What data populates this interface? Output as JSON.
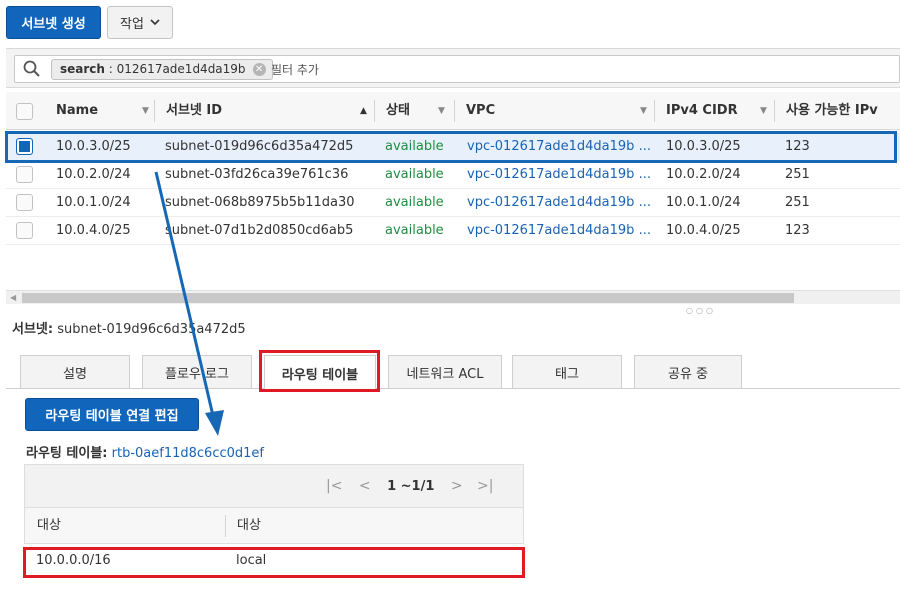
{
  "toolbar": {
    "create_subnet_label": "서브넷 생성",
    "actions_label": "작업"
  },
  "search": {
    "token_key": "search",
    "token_value": "012617ade1d4da19b",
    "filter_placeholder": "필터 추가"
  },
  "table": {
    "columns": [
      "Name",
      "서브넷 ID",
      "상태",
      "VPC",
      "IPv4 CIDR",
      "사용 가능한 IPv"
    ],
    "rows": [
      {
        "name": "10.0.3.0/25",
        "subnet_id": "subnet-019d96c6d35a472d5",
        "state": "available",
        "vpc": "vpc-012617ade1d4da19b ...",
        "cidr": "10.0.3.0/25",
        "available_ips": "123",
        "selected": true
      },
      {
        "name": "10.0.2.0/24",
        "subnet_id": "subnet-03fd26ca39e761c36",
        "state": "available",
        "vpc": "vpc-012617ade1d4da19b ...",
        "cidr": "10.0.2.0/24",
        "available_ips": "251",
        "selected": false
      },
      {
        "name": "10.0.1.0/24",
        "subnet_id": "subnet-068b8975b5b11da30",
        "state": "available",
        "vpc": "vpc-012617ade1d4da19b ...",
        "cidr": "10.0.1.0/24",
        "available_ips": "251",
        "selected": false
      },
      {
        "name": "10.0.4.0/25",
        "subnet_id": "subnet-07d1b2d0850cd6ab5",
        "state": "available",
        "vpc": "vpc-012617ade1d4da19b ...",
        "cidr": "10.0.4.0/25",
        "available_ips": "123",
        "selected": false
      }
    ]
  },
  "detail": {
    "subnet_label": "서브넷:",
    "subnet_value": "subnet-019d96c6d35a472d5",
    "tabs": [
      "설명",
      "플로우 로그",
      "라우팅 테이블",
      "네트워크 ACL",
      "태그",
      "공유 중"
    ],
    "active_tab": "라우팅 테이블",
    "edit_button_label": "라우팅 테이블 연결 편집",
    "route_table_label": "라우팅 테이블:",
    "route_table_id": "rtb-0aef11d8c6cc0d1ef",
    "pagination": "1 ~1/1",
    "route_columns": [
      "대상",
      "대상"
    ],
    "routes": [
      {
        "destination": "10.0.0.0/16",
        "target": "local"
      }
    ]
  },
  "colors": {
    "primary": "#1166bb",
    "highlight_red": "#e01a22",
    "highlight_blue": "#1667b6",
    "status_green": "#1e8e3e",
    "link_blue": "#1a62b3"
  }
}
